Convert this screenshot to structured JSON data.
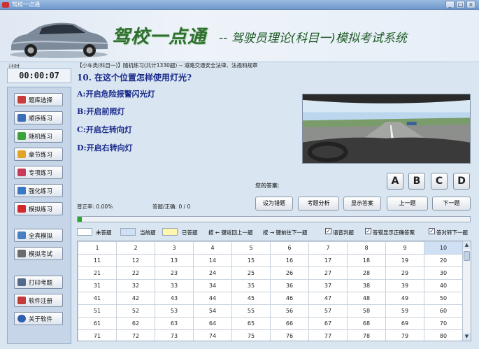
{
  "window": {
    "title": "驾校一点通",
    "buttons": [
      "_",
      "□",
      "×"
    ]
  },
  "banner": {
    "logo": "驾校一点通",
    "subtitle": "-- 驾驶员理论(科目一)模拟考试系统"
  },
  "timer": {
    "label": "计时",
    "value": "00:00:07"
  },
  "sidebar": {
    "items": [
      {
        "label": "题库选择",
        "icon": "library-icon",
        "color": "#c93c3c"
      },
      {
        "label": "顺序练习",
        "icon": "edit-icon",
        "color": "#3a6fb8"
      },
      {
        "label": "随机练习",
        "icon": "shuffle-icon",
        "color": "#3aa43a"
      },
      {
        "label": "章节练习",
        "icon": "folder-icon",
        "color": "#e0a526"
      },
      {
        "label": "专项练习",
        "icon": "checklist-icon",
        "color": "#c83a5a"
      },
      {
        "label": "强化练习",
        "icon": "chart-icon",
        "color": "#3b78c4"
      },
      {
        "label": "模拟练习",
        "icon": "flag-icon",
        "color": "#d22a2a"
      },
      {
        "label": "全真模拟",
        "icon": "monitor-icon",
        "color": "#4a7fc1"
      },
      {
        "label": "模拟考试",
        "icon": "document-icon",
        "color": "#6b6b6b"
      },
      {
        "label": "打印考题",
        "icon": "printer-icon",
        "color": "#546a8a"
      },
      {
        "label": "软件注册",
        "icon": "tools-icon",
        "color": "#c33a3a"
      },
      {
        "label": "关于软件",
        "icon": "info-icon",
        "color": "#2f5fb0"
      }
    ]
  },
  "main": {
    "breadcrumb": "【小车类(科目一)】随机练习(共计1330题) -- 道路交通安全法律、法规和规章",
    "question": "10. 在这个位置怎样使用灯光?",
    "options": [
      "A:开启危险报警闪光灯",
      "B:开启前照灯",
      "C:开启左转向灯",
      "D:开启右转向灯"
    ],
    "answer_label": "您的答案:",
    "answer_buttons": [
      "A",
      "B",
      "C",
      "D"
    ],
    "accuracy": "普正率: 0.00%",
    "answered": "答题/正确: 0 / 0",
    "actions": [
      "设为错题",
      "考题分析",
      "显示答案",
      "上一题",
      "下一题"
    ],
    "progress": 0.01,
    "legend": {
      "unanswered": "未答题",
      "current": "当前题",
      "answered": "已答题",
      "nav_hint_prev": "按 ← 键返回上一题",
      "nav_hint_next": "按 → 键前往下一题",
      "voice": "语音判题",
      "show_correct": "答错显示正确答案",
      "auto_next": "答对转下一题"
    },
    "current_question": 10,
    "grid": [
      [
        "1",
        "2",
        "3",
        "4",
        "5",
        "6",
        "7",
        "8",
        "9",
        "10"
      ],
      [
        "11",
        "12",
        "13",
        "14",
        "15",
        "16",
        "17",
        "18",
        "19",
        "20"
      ],
      [
        "21",
        "22",
        "23",
        "24",
        "25",
        "26",
        "27",
        "28",
        "29",
        "30"
      ],
      [
        "31",
        "32",
        "33",
        "34",
        "35",
        "36",
        "37",
        "38",
        "39",
        "40"
      ],
      [
        "41",
        "42",
        "43",
        "44",
        "45",
        "46",
        "47",
        "48",
        "49",
        "50"
      ],
      [
        "51",
        "52",
        "53",
        "54",
        "55",
        "56",
        "57",
        "58",
        "59",
        "60"
      ],
      [
        "61",
        "62",
        "63",
        "64",
        "65",
        "66",
        "67",
        "68",
        "69",
        "70"
      ],
      [
        "71",
        "72",
        "73",
        "74",
        "75",
        "76",
        "77",
        "78",
        "79",
        "80"
      ]
    ],
    "colors": {
      "unanswered": "#ffffff",
      "current": "#cfe0f4",
      "answered": "#fff6b0"
    }
  }
}
